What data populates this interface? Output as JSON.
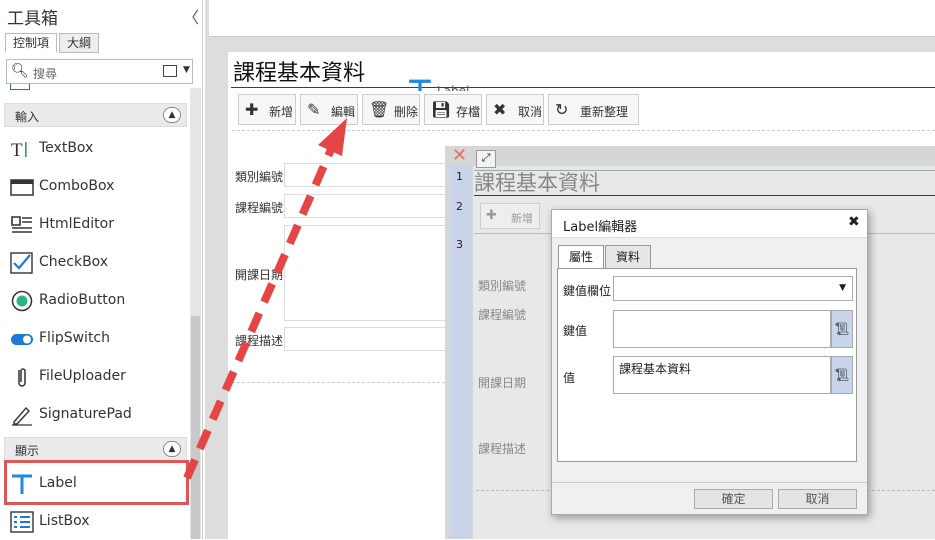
{
  "toolbox": {
    "title": "工具箱",
    "collapse_glyph": "〈",
    "tabs": [
      "控制項",
      "大綱"
    ],
    "search_placeholder": "搜尋",
    "sections": {
      "input": "輸入",
      "display": "顯示"
    },
    "input_items": [
      "TextBox",
      "ComboBox",
      "HtmlEditor",
      "CheckBox",
      "RadioButton",
      "FlipSwitch",
      "FileUploader",
      "SignaturePad"
    ],
    "display_items": [
      "Label",
      "ListBox"
    ]
  },
  "designer": {
    "page_title": "課程基本資料",
    "drag_label": "Label",
    "toolbar": {
      "add": "新增",
      "edit": "編輯",
      "delete": "刪除",
      "save": "存檔",
      "cancel": "取消",
      "refresh": "重新整理"
    },
    "fields": [
      "類別編號",
      "課程編號",
      "開課日期",
      "課程描述"
    ]
  },
  "preview": {
    "row_numbers": [
      "1",
      "2",
      "3"
    ],
    "title": "課程基本資料",
    "add": "新增",
    "fields": [
      "類別編號",
      "課程編號",
      "開課日期",
      "課程描述"
    ]
  },
  "dialog": {
    "title": "Label編輯器",
    "tabs": [
      "屬性",
      "資料"
    ],
    "key_field_label": "鍵值欄位",
    "key_value_label": "鍵值",
    "value_label": "值",
    "value_text": "課程基本資料",
    "ok": "確定",
    "cancel": "取消"
  },
  "colors": {
    "accent_blue": "#2a2ad4",
    "highlight_red": "#e05555"
  }
}
